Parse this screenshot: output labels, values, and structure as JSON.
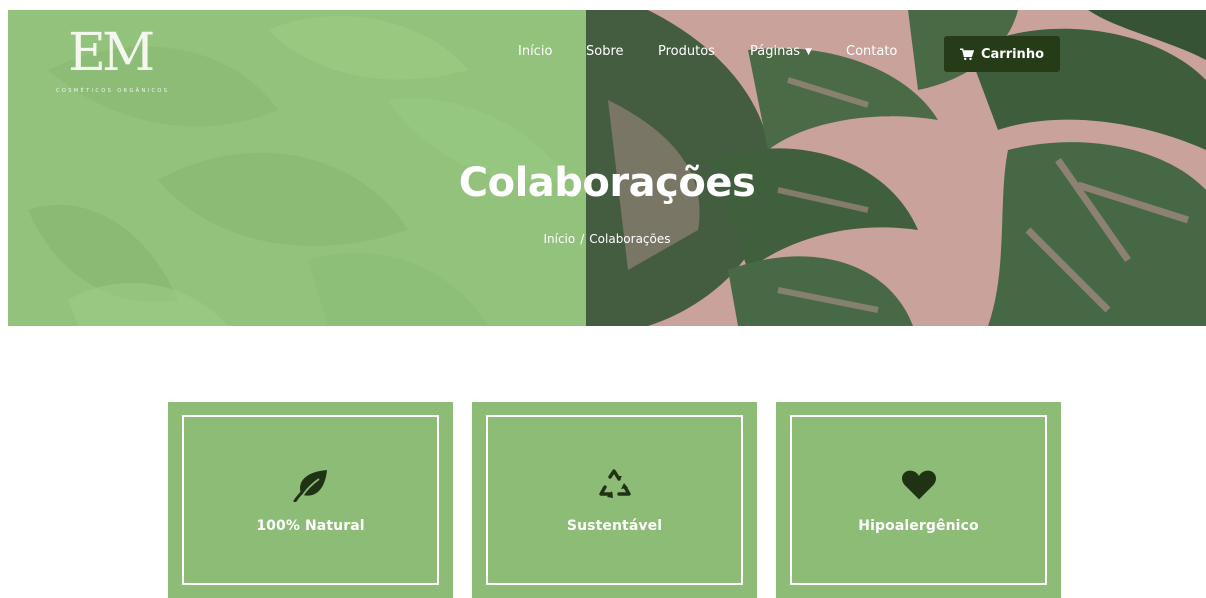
{
  "brand": {
    "logo_text": "EM",
    "logo_subtitle": "COSMÉTICOS ORGÂNICOS"
  },
  "nav": {
    "items": [
      {
        "label": "Início"
      },
      {
        "label": "Sobre"
      },
      {
        "label": "Produtos"
      },
      {
        "label": "Páginas"
      },
      {
        "label": "Contato"
      }
    ],
    "cart_label": "Carrinho"
  },
  "hero": {
    "title": "Colaborações",
    "breadcrumb": {
      "home": "Início",
      "separator": "/",
      "current": "Colaborações"
    }
  },
  "features": [
    {
      "label": "100% Natural",
      "icon": "leaf-icon"
    },
    {
      "label": "Sustentável",
      "icon": "recycle-icon"
    },
    {
      "label": "Hipoalergênico",
      "icon": "heart-icon"
    }
  ],
  "colors": {
    "accent_green": "#8dbc76",
    "dark_green": "#263b17",
    "hero_pink": "#c9a29b",
    "white": "#ffffff"
  }
}
